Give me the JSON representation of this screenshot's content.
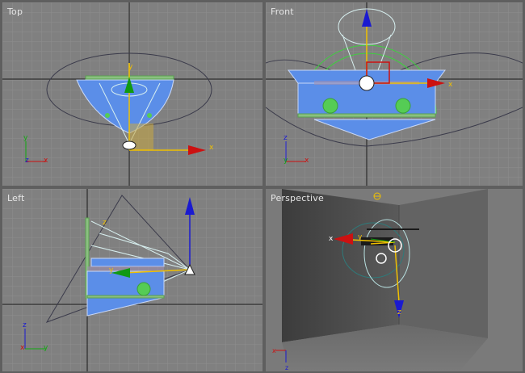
{
  "viewports": {
    "top": {
      "label": "Top",
      "active": true
    },
    "front": {
      "label": "Front",
      "active": false
    },
    "left": {
      "label": "Left",
      "active": false
    },
    "perspective": {
      "label": "Perspective",
      "active": false
    }
  },
  "axis_labels": {
    "x": "x",
    "y": "y",
    "z": "z"
  },
  "colors": {
    "viewport_bg": "#808080",
    "grid_line": "#8e8e8e",
    "active_border": "#e6d22a",
    "object_fill": "#5b8ee8",
    "gizmo_x": "#cc1111",
    "gizmo_y": "#119911",
    "gizmo_z": "#1a1ad0",
    "light_helper": "#b8e0e0"
  }
}
